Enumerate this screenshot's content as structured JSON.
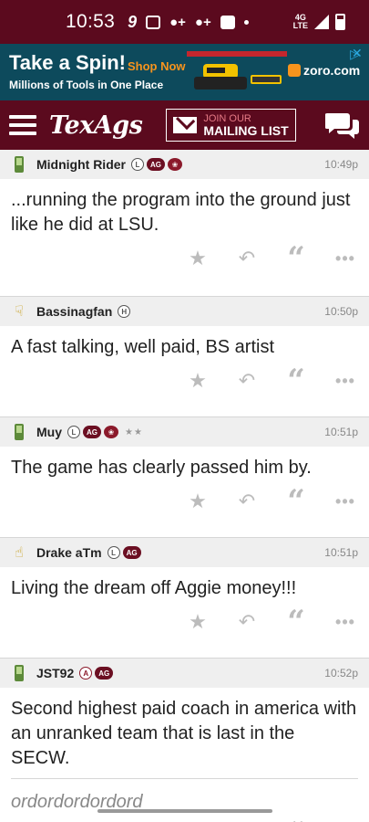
{
  "status_bar": {
    "time": "10:53",
    "net_top": "4G",
    "net_bottom": "LTE",
    "icons": [
      "nine-app-icon",
      "camera-icon",
      "add-person-icon",
      "add-person-icon",
      "facebook-icon",
      "dot-icon",
      "network-icon",
      "signal-icon",
      "battery-icon"
    ]
  },
  "ad": {
    "title": "Take a Spin!",
    "shop_now": "Shop Now",
    "subtitle": "Millions of Tools in One Place",
    "brand": "zoro.com",
    "colors": {
      "background": "#0d4a5c",
      "accent": "#f7941d"
    }
  },
  "header": {
    "logo": "TexAgs",
    "mailing_line1": "JOIN OUR",
    "mailing_line2": "MAILING LIST",
    "colors": {
      "brand": "#5b0a1e"
    }
  },
  "posts": [
    {
      "user": "Midnight Rider",
      "time": "10:49p",
      "text": "...running the program into the ground just like he did at LSU.",
      "badges": [
        "L",
        "AG",
        "seal"
      ],
      "avatar": "phone-icon"
    },
    {
      "user": "Bassinagfan",
      "time": "10:50p",
      "text": "A fast talking, well paid, BS artist",
      "badges": [
        "H"
      ],
      "avatar": "thumbs-down-icon"
    },
    {
      "user": "Muy",
      "time": "10:51p",
      "text": "The game has clearly passed him by.",
      "badges": [
        "L",
        "AG",
        "seal"
      ],
      "stars": "★★",
      "avatar": "phone-icon"
    },
    {
      "user": "Drake aTm",
      "time": "10:51p",
      "text": "Living the dream off Aggie money!!!",
      "badges": [
        "L",
        "AG"
      ],
      "avatar": "thumbs-up-icon"
    },
    {
      "user": "JST92",
      "time": "10:52p",
      "text": "Second highest paid coach in america with an unranked team that is last in the SECW.",
      "badges": [
        "A",
        "AG"
      ],
      "avatar": "phone-icon"
    }
  ],
  "reply": {
    "text": "ordordordordord"
  },
  "actions": {
    "star": "★",
    "reply": "↶",
    "quote": "“",
    "more": "•••"
  }
}
